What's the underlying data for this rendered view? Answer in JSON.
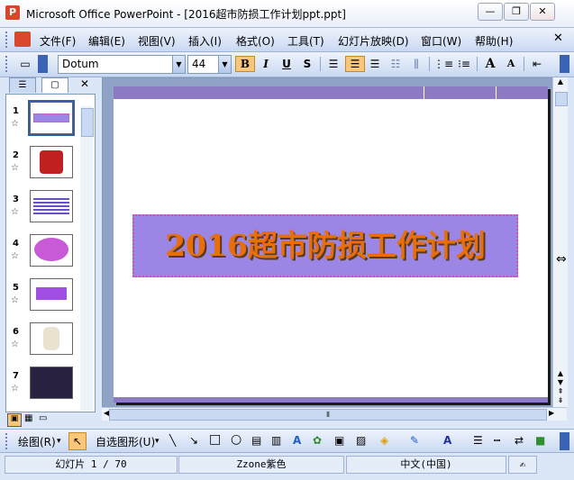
{
  "window": {
    "title": "Microsoft Office PowerPoint - [2016超市防损工作计划ppt.ppt]",
    "app_icon": "P",
    "minimize": "—",
    "restore": "❐",
    "close": "✕"
  },
  "menu": {
    "items": [
      "文件(F)",
      "编辑(E)",
      "视图(V)",
      "插入(I)",
      "格式(O)",
      "工具(T)",
      "幻灯片放映(D)",
      "窗口(W)",
      "帮助(H)"
    ]
  },
  "toolbar": {
    "font_name": "Dotum",
    "font_size": "44",
    "bold": "B",
    "italic": "I",
    "underline": "U",
    "shadow": "S",
    "increase_font": "A",
    "decrease_font": "A"
  },
  "slides_pane": {
    "numbers": [
      "1",
      "2",
      "3",
      "4",
      "5",
      "6",
      "7"
    ],
    "star": "☆"
  },
  "slide": {
    "title": "2016超市防损工作计划"
  },
  "drawbar": {
    "draw_label": "绘图(R)",
    "autoshapes_label": "自选图形(U)"
  },
  "status": {
    "slide_counter": "幻灯片 1 / 70",
    "design": "Zzone紫色",
    "language": "中文(中国)"
  },
  "colors": {
    "title_text": "#e86e0c",
    "title_box": "#9b86e6",
    "slide_band": "#8d7ac4",
    "toolbar_active": "#f9c67a"
  }
}
